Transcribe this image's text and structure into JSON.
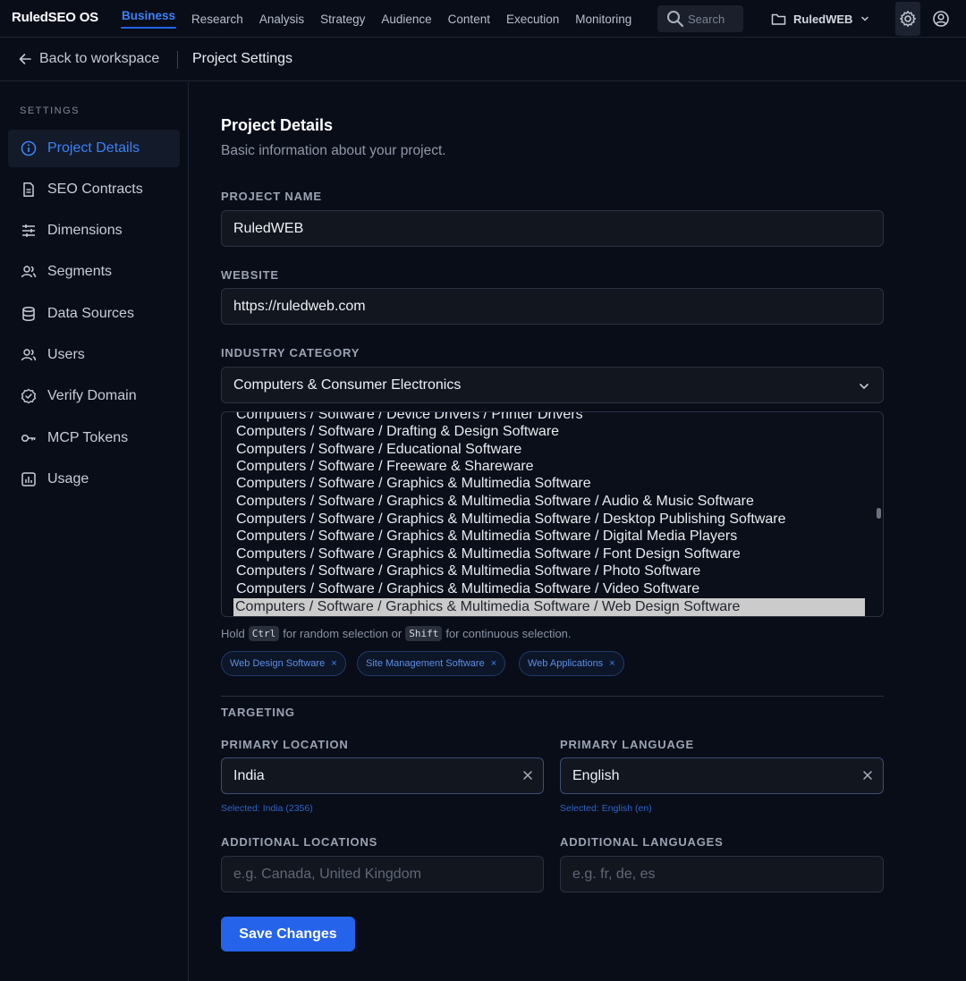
{
  "app": {
    "brand": "RuledSEO OS"
  },
  "nav": {
    "items": [
      {
        "label": "Business",
        "active": true
      },
      {
        "label": "Research"
      },
      {
        "label": "Analysis"
      },
      {
        "label": "Strategy"
      },
      {
        "label": "Audience"
      },
      {
        "label": "Content"
      },
      {
        "label": "Execution"
      },
      {
        "label": "Monitoring"
      }
    ]
  },
  "search": {
    "placeholder": "Search",
    "icon": "search-icon"
  },
  "project_switch": {
    "name": "RuledWEB",
    "icon": "folder-icon"
  },
  "header_icons": {
    "settings": "gear-icon",
    "user": "user-circle-icon"
  },
  "breadcrumb": {
    "back_label": "Back to workspace",
    "current": "Project Settings"
  },
  "sidebar": {
    "heading": "SETTINGS",
    "items": [
      {
        "label": "Project Details",
        "icon": "info-icon",
        "active": true
      },
      {
        "label": "SEO Contracts",
        "icon": "document-icon"
      },
      {
        "label": "Dimensions",
        "icon": "sliders-icon"
      },
      {
        "label": "Segments",
        "icon": "people-icon"
      },
      {
        "label": "Data Sources",
        "icon": "database-icon"
      },
      {
        "label": "Users",
        "icon": "users-icon"
      },
      {
        "label": "Verify Domain",
        "icon": "badge-check-icon"
      },
      {
        "label": "MCP Tokens",
        "icon": "key-icon"
      },
      {
        "label": "Usage",
        "icon": "chart-icon"
      }
    ]
  },
  "main": {
    "title": "Project Details",
    "subtitle": "Basic information about your project.",
    "project_name": {
      "label": "PROJECT NAME",
      "value": "RuledWEB"
    },
    "website": {
      "label": "WEBSITE",
      "value": "https://ruledweb.com"
    },
    "industry": {
      "label": "INDUSTRY CATEGORY",
      "value": "Computers & Consumer Electronics",
      "options": [
        "Computers / Software / Device Drivers / Printer Drivers",
        "Computers / Software / Drafting & Design Software",
        "Computers / Software / Educational Software",
        "Computers / Software / Freeware & Shareware",
        "Computers / Software / Graphics & Multimedia Software",
        "Computers / Software / Graphics & Multimedia Software / Audio & Music Software",
        "Computers / Software / Graphics & Multimedia Software / Desktop Publishing Software",
        "Computers / Software / Graphics & Multimedia Software / Digital Media Players",
        "Computers / Software / Graphics & Multimedia Software / Font Design Software",
        "Computers / Software / Graphics & Multimedia Software / Photo Software",
        "Computers / Software / Graphics & Multimedia Software / Video Software",
        "Computers / Software / Graphics & Multimedia Software / Web Design Software"
      ],
      "selected_option": "Computers / Software / Graphics & Multimedia Software / Web Design Software",
      "hint": {
        "prefix": "Hold",
        "key1": "Ctrl",
        "middle": "for random selection or",
        "key2": "Shift",
        "suffix": "for continuous selection."
      },
      "tags": [
        "Web Design Software",
        "Site Management Software",
        "Web Applications"
      ],
      "tag_remove": "×"
    },
    "targeting": {
      "heading": "TARGETING",
      "primary_location": {
        "label": "PRIMARY LOCATION",
        "value": "India",
        "selected_note": "Selected: India (2356)"
      },
      "primary_language": {
        "label": "PRIMARY LANGUAGE",
        "value": "English",
        "selected_note": "Selected: English (en)"
      },
      "additional_locations": {
        "label": "ADDITIONAL LOCATIONS",
        "placeholder": "e.g. Canada, United Kingdom"
      },
      "additional_languages": {
        "label": "ADDITIONAL LANGUAGES",
        "placeholder": "e.g. fr, de, es"
      }
    },
    "save_label": "Save Changes"
  },
  "colors": {
    "accent": "#2563eb",
    "background": "#090d18",
    "panel": "#12161f"
  }
}
